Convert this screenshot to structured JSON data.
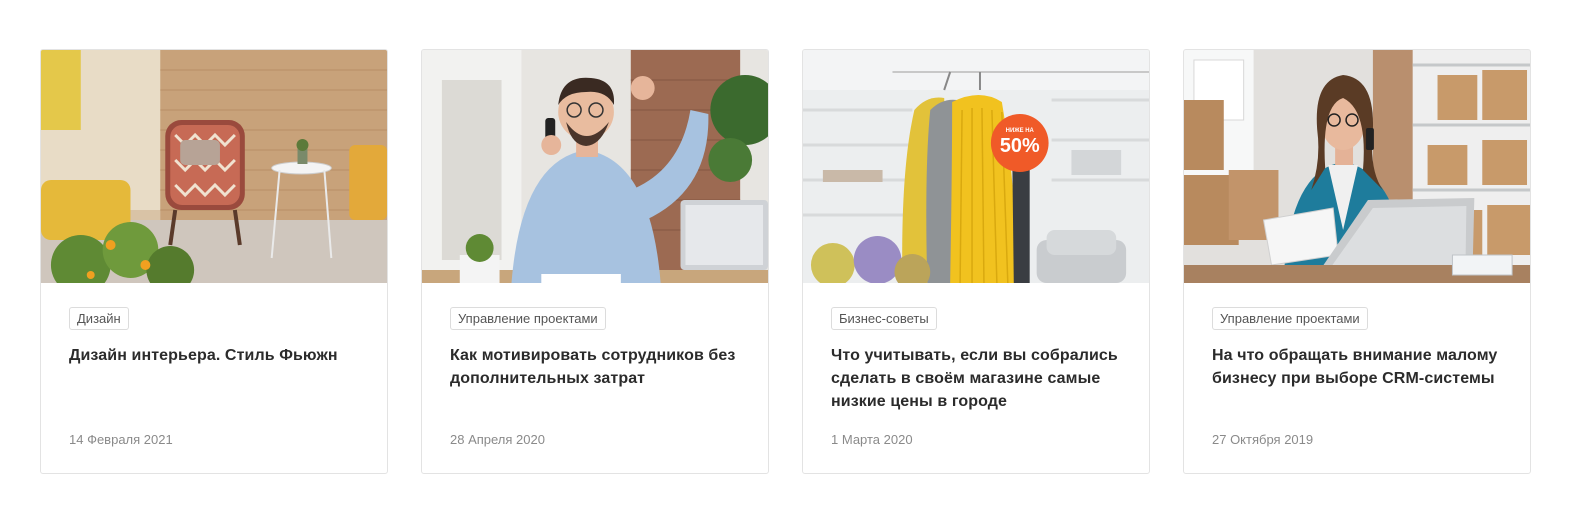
{
  "articles": [
    {
      "tag": "Дизайн",
      "title": "Дизайн интерьера. Стиль Фьюжн",
      "date": "14 Февраля 2021",
      "image": "interior-armchair-photo"
    },
    {
      "tag": "Управление проектами",
      "title": "Как мотивировать сотрудников без дополнительных затрат",
      "date": "28 Апреля 2020",
      "image": "happy-man-on-phone-photo"
    },
    {
      "tag": "Бизнес-советы",
      "title": "Что учитывать, если вы собрались сделать в своём магазине самые низкие цены в городе",
      "date": "1 Марта 2020",
      "image": "clothes-rack-sale-photo",
      "badge_small": "НИЖЕ НА",
      "badge_big": "50%"
    },
    {
      "tag": "Управление проектами",
      "title": "На что обращать внимание малому бизнесу при выборе CRM-системы",
      "date": "27 Октября 2019",
      "image": "woman-with-laptop-photo"
    }
  ],
  "colors": {
    "border": "#e3e3e3",
    "sale_badge": "#f05a28",
    "text_dark": "#2b2b2b",
    "text_muted": "#8a8a8a"
  }
}
